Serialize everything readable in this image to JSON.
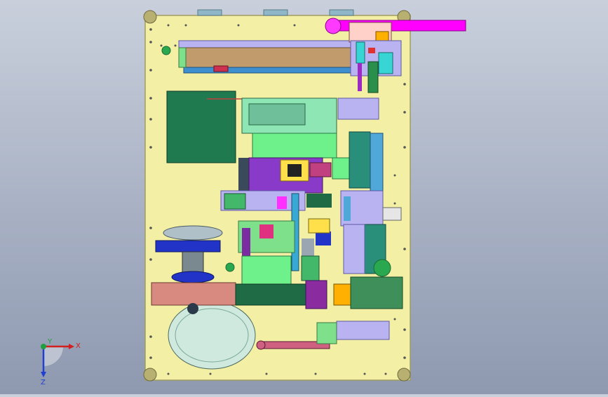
{
  "app": {
    "view": "cad-viewport"
  },
  "triad": {
    "x_label": "X",
    "y_label": "Y",
    "z_label": "Z"
  },
  "colors": {
    "background_top": "#c9d0dc",
    "background_bottom": "#8e99b0",
    "plate": "#f3f0a5",
    "plate_edge": "#a09c60",
    "magenta": "#ff00ff",
    "green_block": "#1f7a50",
    "teal_disc": "#cfe9de",
    "salmon_bar": "#d98a80",
    "dark_green_bar": "#1e6b45",
    "blue_block": "#2234c8",
    "purple": "#7a2ca0",
    "lime": "#44dd66",
    "cyan": "#44cccc",
    "brown_rail": "#b8956a",
    "lavender": "#b9b3f2"
  }
}
